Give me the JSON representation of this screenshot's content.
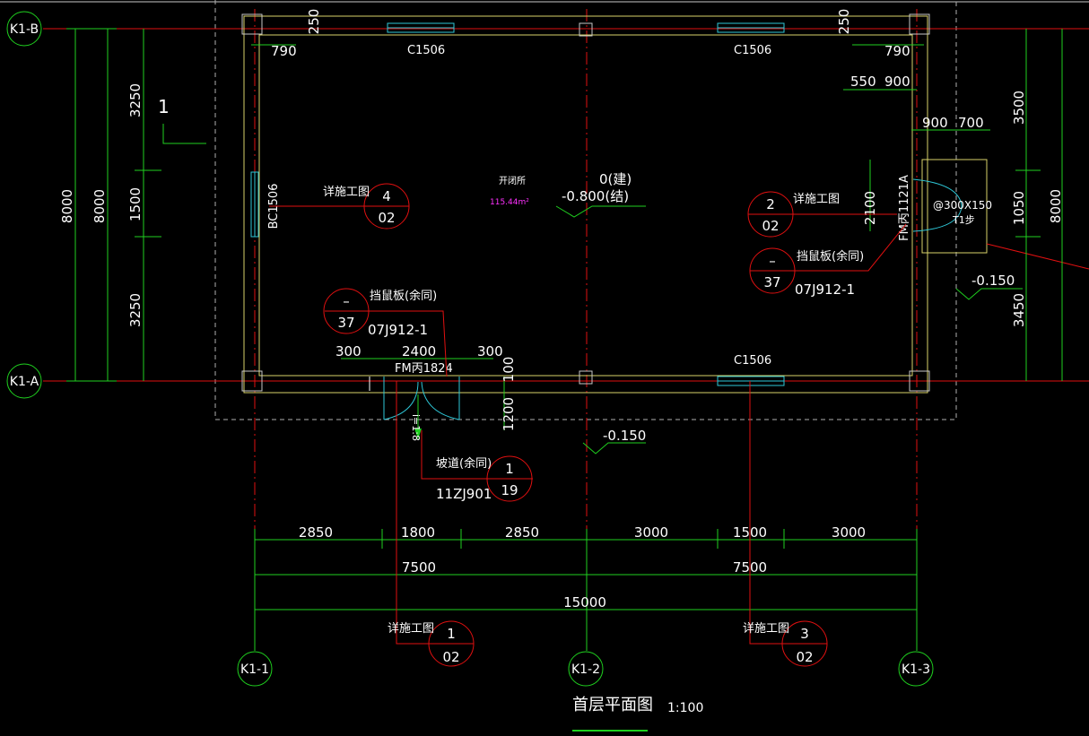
{
  "colors": {
    "background": "#000000",
    "dimension": "#1fd01f",
    "axis": "#e01010",
    "wall": "#d8d26a",
    "window": "#2ec8d8",
    "text": "#ffffff",
    "area": "#ff30ff"
  },
  "axes": {
    "top": "K1-B",
    "bottom": "K1-A",
    "col1": "K1-1",
    "col2": "K1-2",
    "col3": "K1-3"
  },
  "dims_left": {
    "total": "8000",
    "total2": "8000",
    "seg1": "3250",
    "seg2": "1500",
    "seg3": "3250"
  },
  "dims_right": {
    "total": "8000",
    "seg1": "3500",
    "seg2": "1050",
    "seg3": "3450"
  },
  "dims_bottom": {
    "s1": "2850",
    "s2": "1800",
    "s3": "2850",
    "s4": "3000",
    "s5": "1500",
    "s6": "3000",
    "h1": "7500",
    "h2": "7500",
    "total": "15000"
  },
  "dims_misc": {
    "top_left_790": "790",
    "top_right_790": "790",
    "d250a": "250",
    "d250b": "250",
    "d550": "550",
    "d900a": "900",
    "d900b": "900",
    "d700": "700",
    "d2100": "2100",
    "d300a": "300",
    "d2400": "2400",
    "d300b": "300",
    "d100": "100",
    "d1200": "1200"
  },
  "windows": {
    "w1": "C1506",
    "w2": "C1506",
    "w3": "C1506",
    "side": "BC1506"
  },
  "doors": {
    "main": "FM丙1824",
    "side": "FM丙1121A"
  },
  "room": {
    "name": "开闭所",
    "area": "115.44m²",
    "level1": "0(建)",
    "level2": "-0.800(结)",
    "ramp_slope": "i=1:8"
  },
  "levels": {
    "outside_right": "-0.150",
    "outside_bottom": "-0.150"
  },
  "callouts": {
    "c1": {
      "label": "详施工图",
      "top": "4",
      "bottom": "02"
    },
    "c2": {
      "label": "详施工图",
      "top": "2",
      "bottom": "02"
    },
    "c3": {
      "label": "挡鼠板(余同)",
      "top": "–",
      "bottom": "37",
      "ref": "07J912-1"
    },
    "c4": {
      "label": "挡鼠板(余同)",
      "top": "–",
      "bottom": "37",
      "ref": "07J912-1"
    },
    "c5": {
      "label": "坡道(余同)",
      "top": "1",
      "bottom": "19",
      "ref": "11ZJ901"
    },
    "c6": {
      "label": "详施工图",
      "top": "1",
      "bottom": "02"
    },
    "c7": {
      "label": "详施工图",
      "top": "3",
      "bottom": "02"
    }
  },
  "step": {
    "size": "@300X150",
    "label": "T1步"
  },
  "section_mark": "1",
  "drawing_title": "首层平面图",
  "scale": "1:100"
}
